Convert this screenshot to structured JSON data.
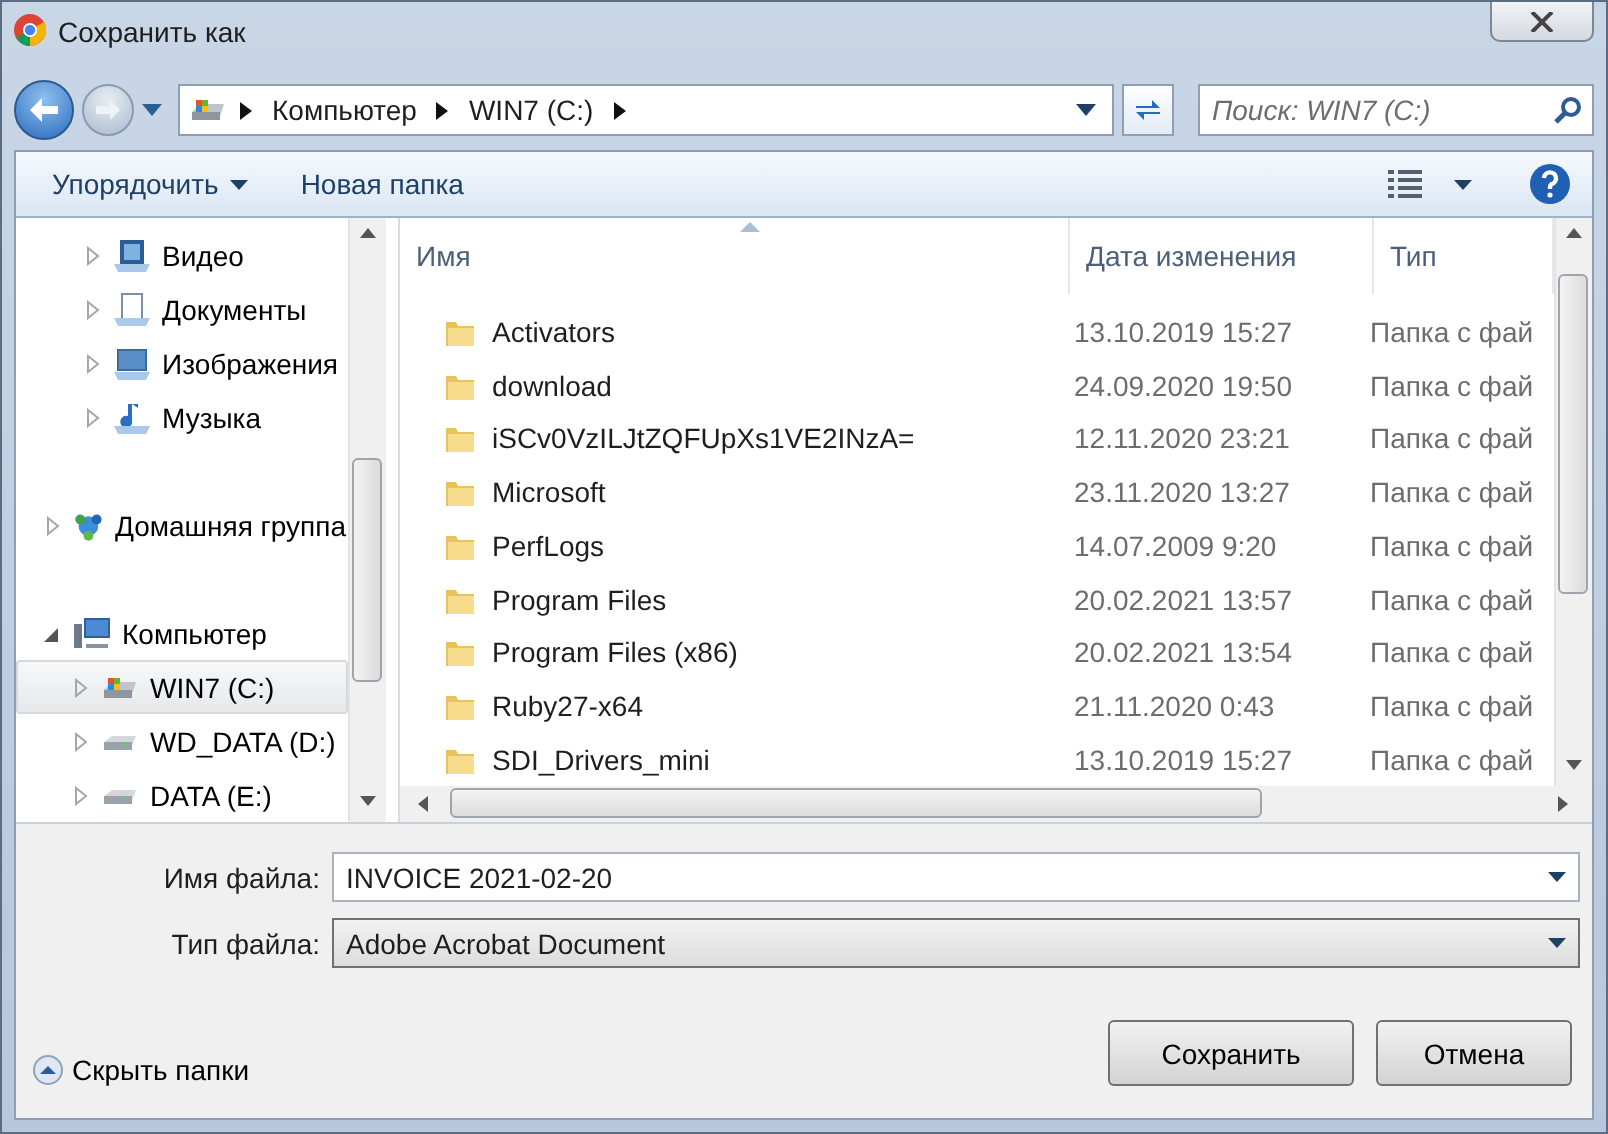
{
  "window": {
    "title": "Сохранить как"
  },
  "address": {
    "crumbs": [
      "Компьютер",
      "WIN7 (C:)"
    ],
    "search_placeholder": "Поиск: WIN7 (C:)"
  },
  "toolbar": {
    "organize": "Упорядочить",
    "new_folder": "Новая папка"
  },
  "sidebar": {
    "library_items": [
      {
        "label": "Видео",
        "kind": "video",
        "expanded": false,
        "selected": false
      },
      {
        "label": "Документы",
        "kind": "documents",
        "expanded": false,
        "selected": false
      },
      {
        "label": "Изображения",
        "kind": "pictures",
        "expanded": false,
        "selected": false
      },
      {
        "label": "Музыка",
        "kind": "music",
        "expanded": false,
        "selected": false
      }
    ],
    "items": [
      {
        "label": "Домашняя группа",
        "kind": "homegroup",
        "expanded": false,
        "selected": false
      },
      {
        "label": "Компьютер",
        "kind": "computer",
        "expanded": true,
        "selected": false,
        "children": [
          {
            "label": "WIN7 (C:)",
            "kind": "system-drive",
            "expanded": false,
            "selected": true
          },
          {
            "label": "WD_DATA (D:)",
            "kind": "drive",
            "expanded": false,
            "selected": false
          },
          {
            "label": "DATA (E:)",
            "kind": "drive",
            "expanded": false,
            "selected": false
          }
        ]
      }
    ]
  },
  "table": {
    "columns": [
      "Имя",
      "Дата изменения",
      "Тип"
    ],
    "rows": [
      {
        "name": "Activators",
        "date": "13.10.2019 15:27",
        "type": "Папка с фай"
      },
      {
        "name": "download",
        "date": "24.09.2020 19:50",
        "type": "Папка с фай"
      },
      {
        "name": "iSCv0VzILJtZQFUpXs1VE2INzA=",
        "date": "12.11.2020 23:21",
        "type": "Папка с фай"
      },
      {
        "name": "Microsoft",
        "date": "23.11.2020 13:27",
        "type": "Папка с фай"
      },
      {
        "name": "PerfLogs",
        "date": "14.07.2009 9:20",
        "type": "Папка с фай"
      },
      {
        "name": "Program Files",
        "date": "20.02.2021 13:57",
        "type": "Папка с фай"
      },
      {
        "name": "Program Files (x86)",
        "date": "20.02.2021 13:54",
        "type": "Папка с фай"
      },
      {
        "name": "Ruby27-x64",
        "date": "21.11.2020 0:43",
        "type": "Папка с фай"
      },
      {
        "name": "SDI_Drivers_mini",
        "date": "13.10.2019 15:27",
        "type": "Папка с фай"
      }
    ]
  },
  "form": {
    "filename_label": "Имя файла:",
    "filename": "INVOICE 2021-02-20",
    "filetype_label": "Тип файла:",
    "filetype": "Adobe Acrobat Document"
  },
  "footer": {
    "hide_folders": "Скрыть папки",
    "save": "Сохранить",
    "cancel": "Отмена"
  }
}
